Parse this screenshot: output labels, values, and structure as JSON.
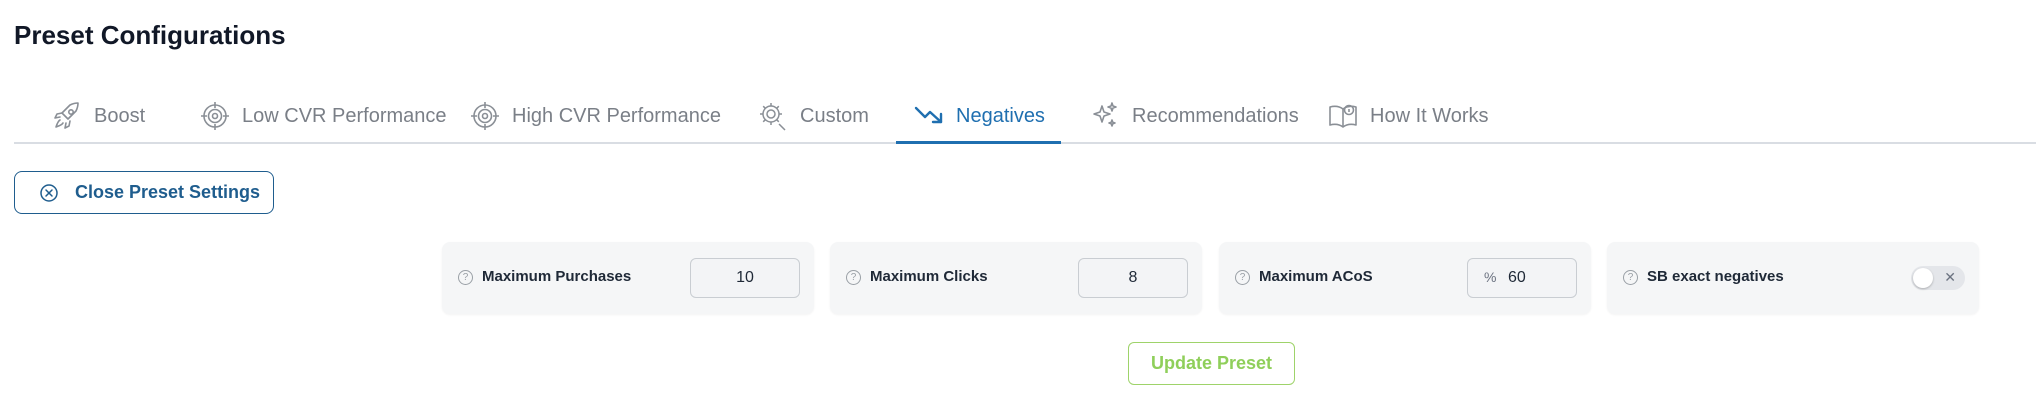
{
  "page_title": "Preset Configurations",
  "tabs": [
    {
      "label": "Boost",
      "icon": "rocket-icon"
    },
    {
      "label": "Low CVR Performance",
      "icon": "target-icon"
    },
    {
      "label": "High CVR Performance",
      "icon": "target-icon"
    },
    {
      "label": "Custom",
      "icon": "gear-icon"
    },
    {
      "label": "Negatives",
      "icon": "trending-down-icon",
      "active": true
    },
    {
      "label": "Recommendations",
      "icon": "sparkles-icon"
    },
    {
      "label": "How It Works",
      "icon": "book-info-icon"
    }
  ],
  "close_button": {
    "label": "Close Preset Settings",
    "icon": "close-circle-icon"
  },
  "settings": {
    "max_purchases": {
      "label": "Maximum Purchases",
      "value": "10"
    },
    "max_clicks": {
      "label": "Maximum Clicks",
      "value": "8"
    },
    "max_acos": {
      "label": "Maximum ACoS",
      "prefix": "%",
      "value": "60"
    },
    "sb_exact_negatives": {
      "label": "SB exact negatives",
      "toggle_symbol": "✕",
      "enabled": false
    }
  },
  "update_button": {
    "label": "Update Preset"
  },
  "colors": {
    "accent": "#1f6fb0",
    "update_green": "#8fcf5a",
    "tab_inactive": "#7a7f87"
  }
}
